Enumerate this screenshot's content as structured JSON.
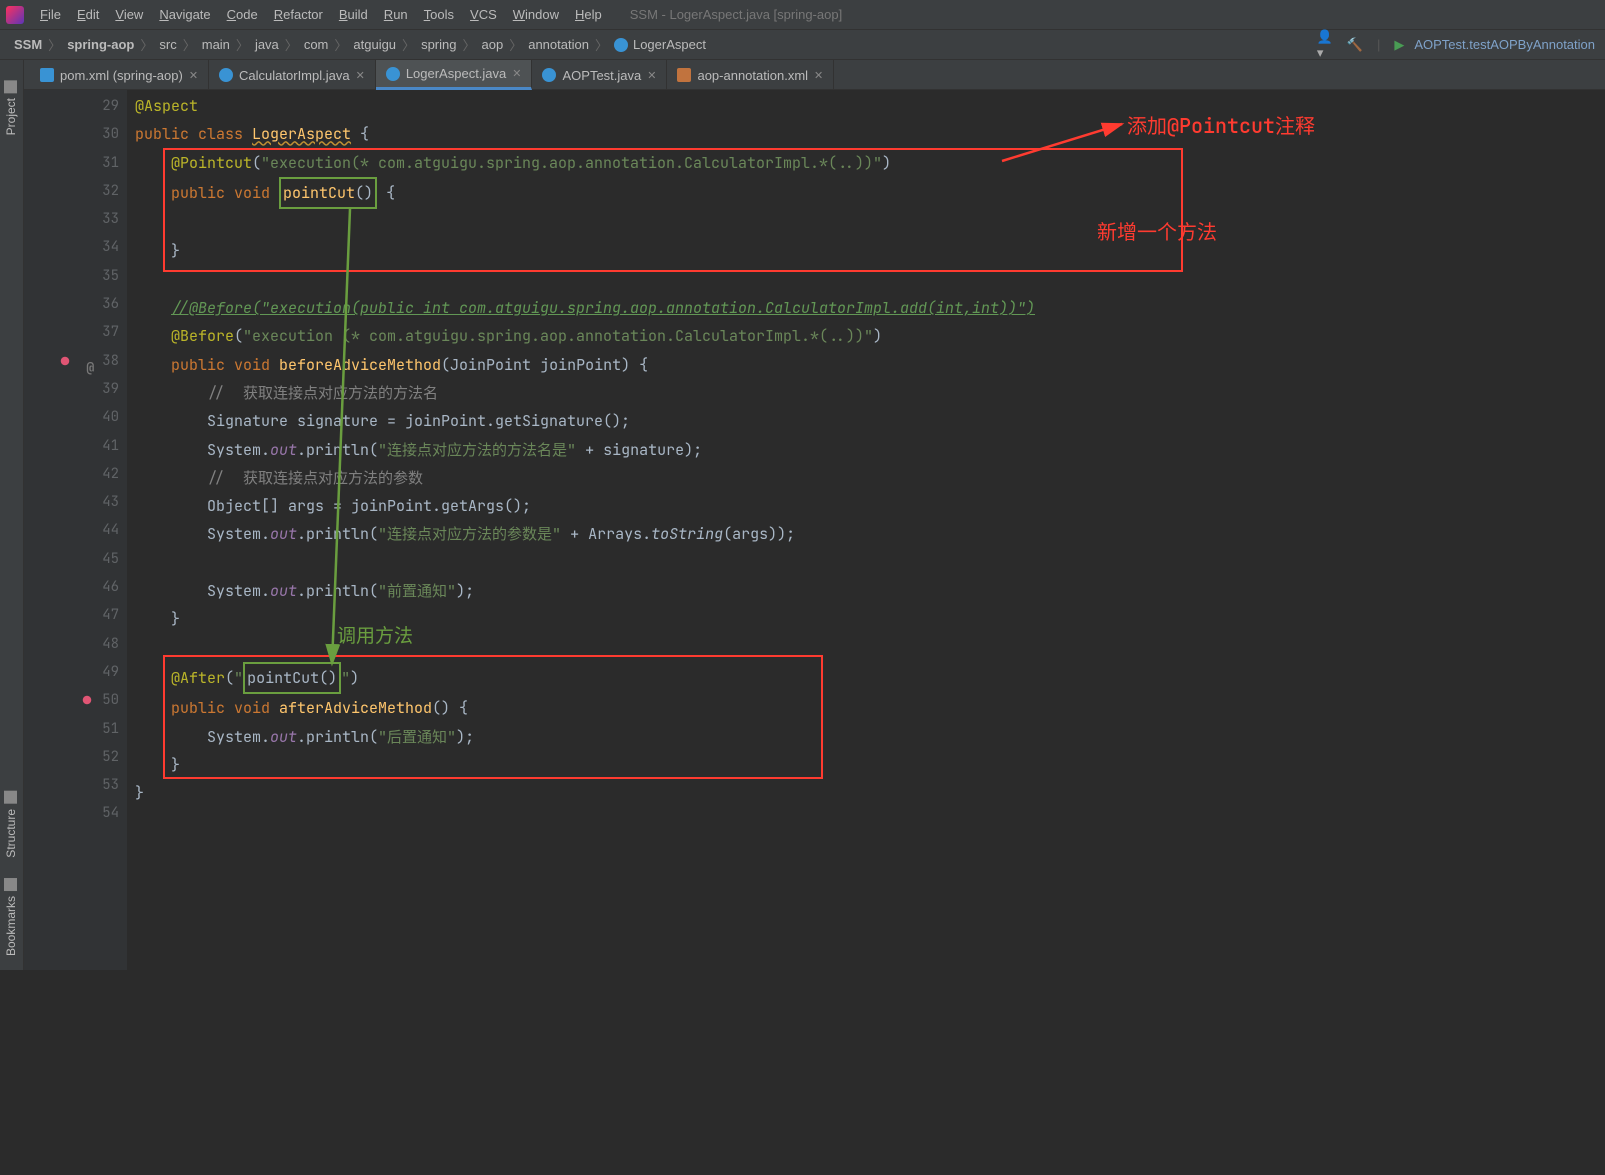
{
  "window_title": "SSM - LogerAspect.java [spring-aop]",
  "menu": [
    "File",
    "Edit",
    "View",
    "Navigate",
    "Code",
    "Refactor",
    "Build",
    "Run",
    "Tools",
    "VCS",
    "Window",
    "Help"
  ],
  "breadcrumbs": [
    "SSM",
    "spring-aop",
    "src",
    "main",
    "java",
    "com",
    "atguigu",
    "spring",
    "aop",
    "annotation",
    "LogerAspect"
  ],
  "run_config": "AOPTest.testAOPByAnnotation",
  "tabs": [
    {
      "label": "pom.xml (spring-aop)",
      "icon": "m",
      "active": false
    },
    {
      "label": "CalculatorImpl.java",
      "icon": "c",
      "active": false
    },
    {
      "label": "LogerAspect.java",
      "icon": "c",
      "active": true
    },
    {
      "label": "AOPTest.java",
      "icon": "c",
      "active": false
    },
    {
      "label": "aop-annotation.xml",
      "icon": "x",
      "active": false
    }
  ],
  "side_tabs": [
    "Project",
    "Structure",
    "Bookmarks"
  ],
  "line_start": 29,
  "code_lines": [
    {
      "n": 29,
      "html": "<span class='hl-an'>@Aspect</span>"
    },
    {
      "n": 30,
      "html": "<span class='hl-kw'>public class </span><span class='hl-name orange-underline'>LogerAspect</span> {"
    },
    {
      "n": 31,
      "html": "    <span class='hl-an'>@Pointcut</span>(<span class='hl-str'>\"execution(* com.atguigu.spring.aop.annotation.CalculatorImpl.*(..))\"</span>)"
    },
    {
      "n": 32,
      "html": "    <span class='hl-kw'>public void </span><span class='box-green-sm'><span class='hl-name'>pointCut</span>()</span> {"
    },
    {
      "n": 33,
      "html": ""
    },
    {
      "n": 34,
      "html": "    }"
    },
    {
      "n": 35,
      "html": ""
    },
    {
      "n": 36,
      "html": "    <span class='hl-cm2'>//@Before(\"execution(public int com.atguigu.spring.aop.annotation.CalculatorImpl.add(int,int))\")</span>"
    },
    {
      "n": 37,
      "html": "    <span class='hl-an'>@Before</span>(<span class='hl-str'>\"execution (* com.atguigu.spring.aop.annotation.CalculatorImpl.*(..))\"</span>)"
    },
    {
      "n": 38,
      "html": "    <span class='hl-kw'>public void </span><span class='hl-name'>beforeAdviceMethod</span>(JoinPoint <span class='hl-param'>joinPoint</span>) {"
    },
    {
      "n": 39,
      "html": "        <span class='hl-cm'>//  获取连接点对应方法的方法名</span>"
    },
    {
      "n": 40,
      "html": "        Signature signature = joinPoint.getSignature();"
    },
    {
      "n": 41,
      "html": "        System.<span class='hl-field'>out</span>.println(<span class='hl-str'>\"连接点对应方法的方法名是\"</span> + signature);"
    },
    {
      "n": 42,
      "html": "        <span class='hl-cm'>//  获取连接点对应方法的参数</span>"
    },
    {
      "n": 43,
      "html": "        Object[] args = joinPoint.getArgs();"
    },
    {
      "n": 44,
      "html": "        System.<span class='hl-field'>out</span>.println(<span class='hl-str'>\"连接点对应方法的参数是\"</span> + Arrays.<span class='hl-static'>toString</span>(args));"
    },
    {
      "n": 45,
      "html": ""
    },
    {
      "n": 46,
      "html": "        System.<span class='hl-field'>out</span>.println(<span class='hl-str'>\"前置通知\"</span>);"
    },
    {
      "n": 47,
      "html": "    }"
    },
    {
      "n": 48,
      "html": ""
    },
    {
      "n": 49,
      "html": "    <span class='hl-an'>@After</span>(<span class='hl-str'>\"</span><span class='box-green-sm'>pointCut()</span><span class='hl-str'>\"</span>)"
    },
    {
      "n": 50,
      "html": "    <span class='hl-kw'>public void </span><span class='hl-name'>afterAdviceMethod</span>() {"
    },
    {
      "n": 51,
      "html": "        System.<span class='hl-field'>out</span>.println(<span class='hl-str'>\"后置通知\"</span>);"
    },
    {
      "n": 52,
      "html": "    }"
    },
    {
      "n": 53,
      "html": "}"
    },
    {
      "n": 54,
      "html": ""
    }
  ],
  "annotations": {
    "red1": "添加@Pointcut注释",
    "red2": "新增一个方法",
    "green1": "调用方法"
  }
}
